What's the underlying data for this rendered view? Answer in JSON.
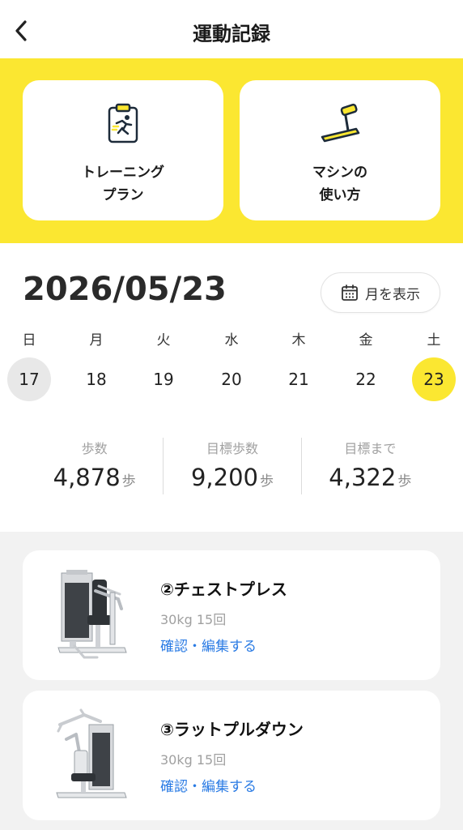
{
  "header": {
    "title": "運動記録",
    "back_icon": "chevron-left-icon"
  },
  "quick_links": [
    {
      "label_line1": "トレーニング",
      "label_line2": "プラン",
      "icon": "clipboard-runner-icon"
    },
    {
      "label_line1": "マシンの",
      "label_line2": "使い方",
      "icon": "treadmill-icon"
    }
  ],
  "date": {
    "title": "2026/05/23",
    "month_button_label": "月を表示",
    "month_button_icon": "calendar-icon"
  },
  "week": [
    {
      "dow": "日",
      "num": "17",
      "state": "today"
    },
    {
      "dow": "月",
      "num": "18",
      "state": ""
    },
    {
      "dow": "火",
      "num": "19",
      "state": ""
    },
    {
      "dow": "水",
      "num": "20",
      "state": ""
    },
    {
      "dow": "木",
      "num": "21",
      "state": ""
    },
    {
      "dow": "金",
      "num": "22",
      "state": ""
    },
    {
      "dow": "土",
      "num": "23",
      "state": "selected"
    }
  ],
  "stats": [
    {
      "label": "歩数",
      "value": "4,878",
      "unit": "歩"
    },
    {
      "label": "目標歩数",
      "value": "9,200",
      "unit": "歩"
    },
    {
      "label": "目標まで",
      "value": "4,322",
      "unit": "歩"
    }
  ],
  "machines": [
    {
      "name": "②チェストプレス",
      "detail": "30kg 15回",
      "link": "確認・編集する"
    },
    {
      "name": "③ラットプルダウン",
      "detail": "30kg 15回",
      "link": "確認・編集する"
    }
  ],
  "colors": {
    "accent_yellow": "#fbe731",
    "link_blue": "#2a7be4",
    "today_gray": "#e8e8e8"
  }
}
